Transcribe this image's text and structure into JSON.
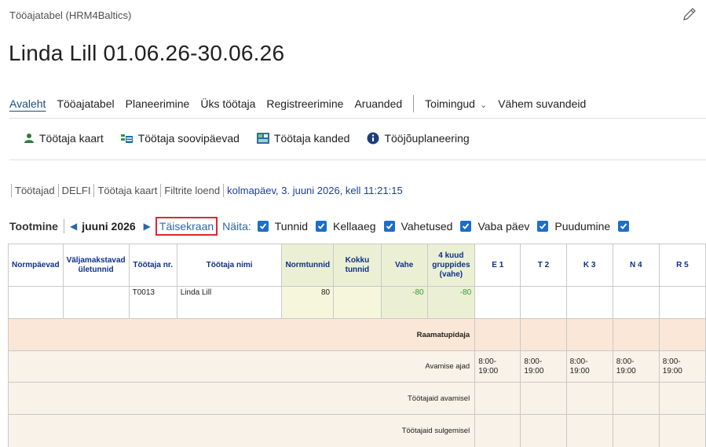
{
  "header": {
    "breadcrumb": "Tööajatabel (HRM4Baltics)",
    "title": "Linda Lill 01.06.26-30.06.26"
  },
  "nav": {
    "items": [
      "Avaleht",
      "Tööajatabel",
      "Planeerimine",
      "Üks töötaja",
      "Registreerimine",
      "Aruanded"
    ],
    "actions_menu": "Toimingud",
    "fewer_options": "Vähem suvandeid"
  },
  "actions": {
    "items": [
      {
        "label": "Töötaja kaart",
        "icon": "person-icon"
      },
      {
        "label": "Töötaja soovipäevad",
        "icon": "calendar-list-icon"
      },
      {
        "label": "Töötaja kanded",
        "icon": "ledger-icon"
      },
      {
        "label": "Tööjõuplaneering",
        "icon": "info-icon"
      }
    ]
  },
  "infobar": {
    "items": [
      "Töötajad",
      "DELFI",
      "Töötaja kaart",
      "Filtrite loend"
    ],
    "date": "kolmapäev, 3. juuni 2026, kell 11:21:15"
  },
  "toolbar": {
    "tootmine": "Tootmine",
    "month": "juuni 2026",
    "fullscreen": "Täisekraan",
    "show_label": "Näita:",
    "checks": [
      "Tunnid",
      "Kellaaeg",
      "Vahetused",
      "Vaba päev",
      "Puudumine"
    ]
  },
  "grid": {
    "headers": {
      "normpaevad": "Normpäevad",
      "valjamaks": "Väljamakstavad ületunnid",
      "nr": "Töötaja nr.",
      "name": "Töötaja nimi",
      "normtunnid": "Normtunnid",
      "kokku": "Kokku tunnid",
      "vahe": "Vahe",
      "grupp": "4 kuud gruppides (vahe)",
      "days": [
        "E 1",
        "T 2",
        "K 3",
        "N 4",
        "R 5"
      ]
    },
    "employee": {
      "nr": "T0013",
      "name": "Linda Lill",
      "normtunnid": "80",
      "vahe": "-80",
      "grupp": "-80"
    },
    "group_label": "Raamatupidaja",
    "rows": {
      "avamise": "Avamise ajad",
      "avamisel": "Töötajaid avamisel",
      "sulgemisel": "Töötajaid sulgemisel"
    },
    "times": [
      "8:00-\n19:00",
      "8:00-\n19:00",
      "8:00-\n19:00",
      "8:00-\n19:00",
      "8:00-\n19:00"
    ]
  },
  "colors": {
    "accent": "#2f67ad",
    "header_text": "#0f2f8a",
    "highlight_border": "#e0272d",
    "checkbox": "#1d6ec7"
  }
}
